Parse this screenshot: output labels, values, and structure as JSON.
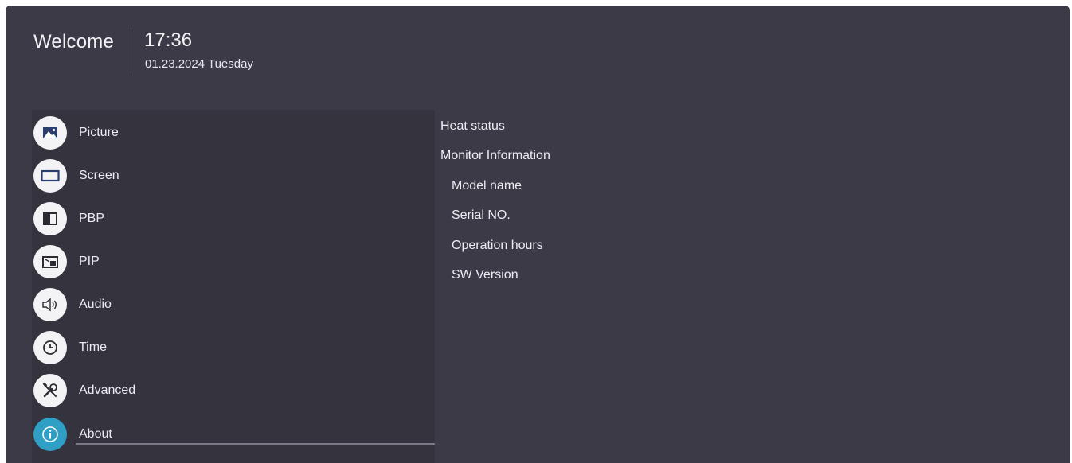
{
  "header": {
    "welcome": "Welcome",
    "time": "17:36",
    "date": "01.23.2024 Tuesday"
  },
  "menu": {
    "items": [
      {
        "label": "Picture",
        "icon": "picture-icon"
      },
      {
        "label": "Screen",
        "icon": "screen-icon"
      },
      {
        "label": "PBP",
        "icon": "pbp-icon"
      },
      {
        "label": "PIP",
        "icon": "pip-icon"
      },
      {
        "label": "Audio",
        "icon": "speaker-icon"
      },
      {
        "label": "Time",
        "icon": "clock-icon"
      },
      {
        "label": "Advanced",
        "icon": "tools-icon"
      },
      {
        "label": "About",
        "icon": "info-icon"
      }
    ],
    "selected": "About"
  },
  "about": {
    "heat_status": "Heat status",
    "monitor_information": "Monitor Information",
    "model_name": "Model name",
    "serial_no": "Serial NO.",
    "operation_hours": "Operation hours",
    "sw_version": "SW Version"
  },
  "colors": {
    "background": "#3b3a46",
    "menu_panel": "#34333e",
    "accent": "#2f9fc6",
    "text": "#ececf1"
  }
}
